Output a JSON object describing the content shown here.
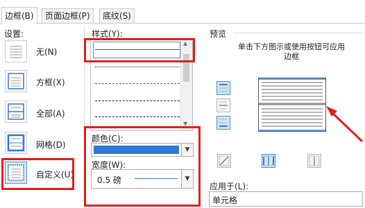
{
  "tabs": [
    "边框(B)",
    "页面边框(P)",
    "底纹(S)"
  ],
  "settings": {
    "heading": "设置:",
    "items": [
      {
        "label": "无(N)",
        "icon": "none-border-icon"
      },
      {
        "label": "方框(X)",
        "icon": "box-border-icon"
      },
      {
        "label": "全部(A)",
        "icon": "all-border-icon"
      },
      {
        "label": "网格(D)",
        "icon": "grid-border-icon"
      },
      {
        "label": "自定义(U)",
        "icon": "custom-border-icon",
        "selected": true
      }
    ]
  },
  "style": {
    "heading": "样式(Y):",
    "lines": [
      {
        "kind": "solid",
        "color": "#1e5aa8",
        "selected": true
      },
      {
        "kind": "dotted",
        "color": "#222222"
      },
      {
        "kind": "dashed-small",
        "color": "#d41e1e"
      },
      {
        "kind": "dashed",
        "color": "#222222"
      },
      {
        "kind": "dash-dot",
        "color": "#222222"
      }
    ]
  },
  "color": {
    "heading": "颜色(C):",
    "value": "#2e78d2"
  },
  "width": {
    "heading": "宽度(W):",
    "value": "0.5 磅"
  },
  "preview": {
    "heading": "预览",
    "instruction": "单击下方图示或使用按钮可应用边框"
  },
  "apply_to": {
    "heading": "应用于(L):",
    "value": "单元格"
  },
  "colors": {
    "highlight": "#e51c1c",
    "accent": "#2e78d2"
  }
}
